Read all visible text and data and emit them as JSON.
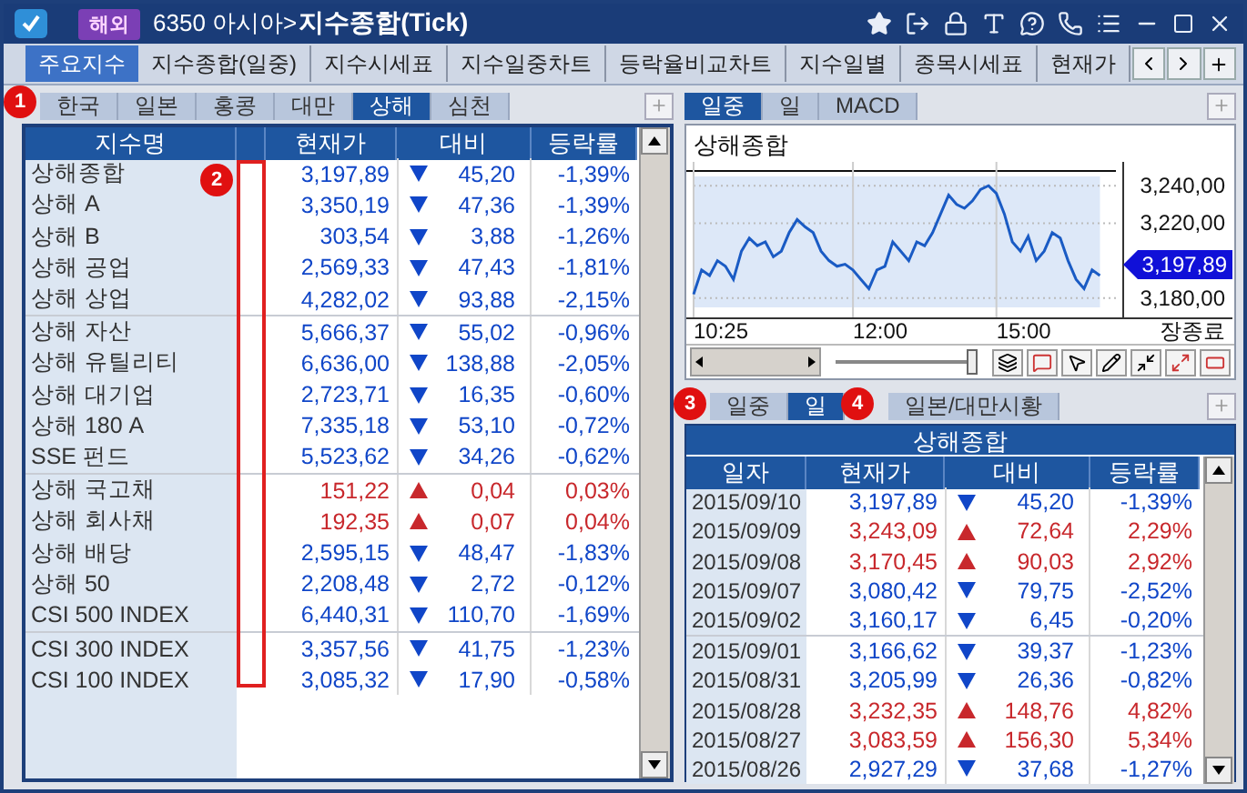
{
  "window": {
    "badge": "해외",
    "code": "6350 아시아>",
    "title": "지수종합(Tick)"
  },
  "main_tabs": [
    {
      "label": "주요지수",
      "selected": true
    },
    {
      "label": "지수종합(일중)",
      "selected": false
    },
    {
      "label": "지수시세표",
      "selected": false
    },
    {
      "label": "지수일중차트",
      "selected": false
    },
    {
      "label": "등락율비교차트",
      "selected": false
    },
    {
      "label": "지수일별",
      "selected": false
    },
    {
      "label": "종목시세표",
      "selected": false
    },
    {
      "label": "현재가",
      "selected": false
    }
  ],
  "region_tabs": [
    {
      "label": "한국",
      "selected": false
    },
    {
      "label": "일본",
      "selected": false
    },
    {
      "label": "홍콩",
      "selected": false
    },
    {
      "label": "대만",
      "selected": false
    },
    {
      "label": "상해",
      "selected": true
    },
    {
      "label": "심천",
      "selected": false
    }
  ],
  "index_table": {
    "columns": [
      "지수명",
      "현재가",
      "대비",
      "등락률"
    ],
    "rows": [
      {
        "name": "상해종합",
        "price": "3,197,89",
        "kind": "down",
        "change": "45,20",
        "rate": "-1,39%"
      },
      {
        "name": "상해 A",
        "price": "3,350,19",
        "kind": "down",
        "change": "47,36",
        "rate": "-1,39%"
      },
      {
        "name": "상해 B",
        "price": "303,54",
        "kind": "down",
        "change": "3,88",
        "rate": "-1,26%"
      },
      {
        "name": "상해 공업",
        "price": "2,569,33",
        "kind": "down",
        "change": "47,43",
        "rate": "-1,81%"
      },
      {
        "name": "상해 상업",
        "price": "4,282,02",
        "kind": "down",
        "change": "93,88",
        "rate": "-2,15%"
      },
      {
        "name": "상해 자산",
        "price": "5,666,37",
        "kind": "down",
        "change": "55,02",
        "rate": "-0,96%"
      },
      {
        "name": "상해 유틸리티",
        "price": "6,636,00",
        "kind": "down",
        "change": "138,88",
        "rate": "-2,05%"
      },
      {
        "name": "상해 대기업",
        "price": "2,723,71",
        "kind": "down",
        "change": "16,35",
        "rate": "-0,60%"
      },
      {
        "name": "상해 180 A",
        "price": "7,335,18",
        "kind": "down",
        "change": "53,10",
        "rate": "-0,72%"
      },
      {
        "name": "SSE 펀드",
        "price": "5,523,62",
        "kind": "down",
        "change": "34,26",
        "rate": "-0,62%"
      },
      {
        "name": "상해 국고채",
        "price": "151,22",
        "kind": "up",
        "change": "0,04",
        "rate": "0,03%"
      },
      {
        "name": "상해 회사채",
        "price": "192,35",
        "kind": "up",
        "change": "0,07",
        "rate": "0,04%"
      },
      {
        "name": "상해 배당",
        "price": "2,595,15",
        "kind": "down",
        "change": "48,47",
        "rate": "-1,83%"
      },
      {
        "name": "상해 50",
        "price": "2,208,48",
        "kind": "down",
        "change": "2,72",
        "rate": "-0,12%"
      },
      {
        "name": "CSI 500 INDEX",
        "price": "6,440,31",
        "kind": "down",
        "change": "110,70",
        "rate": "-1,69%"
      },
      {
        "name": "CSI 300 INDEX",
        "price": "3,357,56",
        "kind": "down",
        "change": "41,75",
        "rate": "-1,23%"
      },
      {
        "name": "CSI 100 INDEX",
        "price": "3,085,32",
        "kind": "down",
        "change": "17,90",
        "rate": "-0,58%"
      }
    ]
  },
  "chart_panel": {
    "tabs": [
      {
        "label": "일중",
        "selected": true
      },
      {
        "label": "일",
        "selected": false
      },
      {
        "label": "MACD",
        "selected": false
      }
    ],
    "title": "상해종합",
    "current_price": "3,197,89",
    "zoom": {
      "level": 1
    },
    "y_labels": [
      "3,240,00",
      "3,220,00",
      "3,180,00"
    ],
    "x_labels": [
      "10:25",
      "12:00",
      "15:00",
      "장종료"
    ]
  },
  "daily_tabs": [
    {
      "label": "일중",
      "selected": false
    },
    {
      "label": "일",
      "selected": true
    },
    {
      "label": "일본/대만시황",
      "selected": false
    }
  ],
  "daily_table": {
    "title": "상해종합",
    "columns": [
      "일자",
      "현재가",
      "대비",
      "등락률"
    ],
    "rows": [
      {
        "date": "2015/09/10",
        "price": "3,197,89",
        "kind": "down",
        "change": "45,20",
        "rate": "-1,39%"
      },
      {
        "date": "2015/09/09",
        "price": "3,243,09",
        "kind": "up",
        "change": "72,64",
        "rate": "2,29%"
      },
      {
        "date": "2015/09/08",
        "price": "3,170,45",
        "kind": "up",
        "change": "90,03",
        "rate": "2,92%"
      },
      {
        "date": "2015/09/07",
        "price": "3,080,42",
        "kind": "down",
        "change": "79,75",
        "rate": "-2,52%"
      },
      {
        "date": "2015/09/02",
        "price": "3,160,17",
        "kind": "down",
        "change": "6,45",
        "rate": "-0,20%"
      },
      {
        "date": "2015/09/01",
        "price": "3,166,62",
        "kind": "down",
        "change": "39,37",
        "rate": "-1,23%"
      },
      {
        "date": "2015/08/31",
        "price": "3,205,99",
        "kind": "down",
        "change": "26,36",
        "rate": "-0,82%"
      },
      {
        "date": "2015/08/28",
        "price": "3,232,35",
        "kind": "up",
        "change": "148,76",
        "rate": "4,82%"
      },
      {
        "date": "2015/08/27",
        "price": "3,083,59",
        "kind": "up",
        "change": "156,30",
        "rate": "5,34%"
      },
      {
        "date": "2015/08/26",
        "price": "2,927,29",
        "kind": "down",
        "change": "37,68",
        "rate": "-1,27%"
      }
    ]
  },
  "callouts": [
    "1",
    "2",
    "3",
    "4"
  ]
}
